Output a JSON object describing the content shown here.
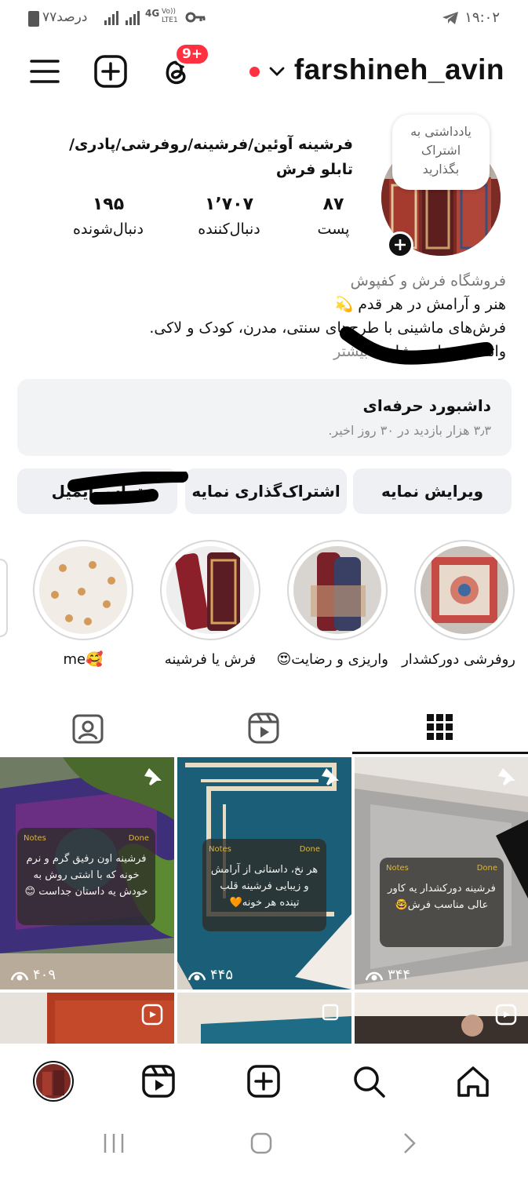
{
  "status_bar": {
    "time": "۱۹:۰۲",
    "battery": "۷۷درصد",
    "network": "4G",
    "volte": "Vo)) LTE1"
  },
  "header": {
    "username": "farshineh_avin",
    "notification_badge": "9+"
  },
  "profile": {
    "note_bubble": "یادداشتی به اشتراک بگذارید",
    "full_name": "فرشینه آوئین/فرشینه/روفرشی/پادری/تابلو فرش",
    "stats": [
      {
        "value": "۸۷",
        "label": "پست"
      },
      {
        "value": "۱٬۷۰۷",
        "label": "دنبال‌کننده"
      },
      {
        "value": "۱۹۵",
        "label": "دنبال‌شونده"
      }
    ],
    "category": "فروشگاه فرش و کفپوش",
    "bio_line1": "هنر و آرامش در هر قدم 💫",
    "bio_line2": "فرش‌های ماشینی با طرح‌های سنتی، مدرن، کودک و لاکی.",
    "bio_line3": "واتساپ برای مشاوره",
    "bio_more": "بیشتر"
  },
  "dashboard": {
    "title": "داشبورد حرفه‌ای",
    "subtitle": "۳٫۳ هزار بازدید در ۳۰ روز اخیر."
  },
  "buttons": {
    "edit_profile": "ویرایش نمایه",
    "share_profile": "اشتراک‌گذاری نمایه",
    "third": "تماس ایمیل"
  },
  "highlights": [
    {
      "label": "روفرشی دورکشدار"
    },
    {
      "label": "واریزی و رضایت😍"
    },
    {
      "label": "فرش یا فرشینه"
    },
    {
      "label": "🥰me"
    }
  ],
  "posts": [
    {
      "note": "فرشینه اون رفیق گرم و نرم خونه که با اشتی روش به خودش یه داستان جداست 😊",
      "views": "۴۰۹"
    },
    {
      "note": "هر نخ، داستانی از آرامش و زیبایی فرشینه قلب تپنده هر خونه🧡",
      "views": "۴۴۵"
    },
    {
      "note": "فرشینه دورکشدار یه کاور عالی مناسب فرش🤓",
      "views": "۳۴۴"
    }
  ],
  "note_app": {
    "back": "Notes",
    "done": "Done"
  },
  "colors": {
    "accent": "#ff3040",
    "button_bg": "#eef0f3",
    "card_bg": "#f2f3f5"
  }
}
